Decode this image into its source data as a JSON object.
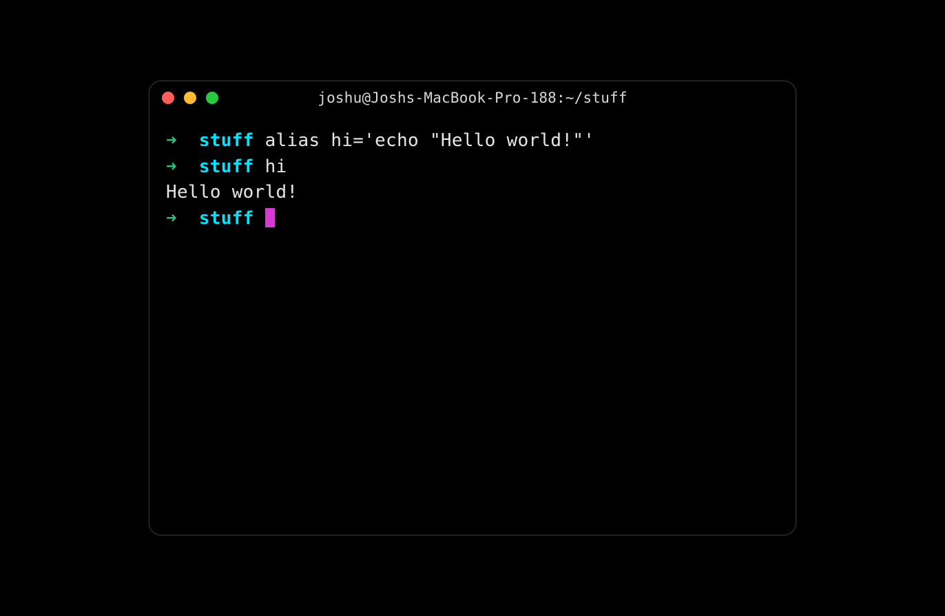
{
  "window": {
    "title": "joshu@Joshs-MacBook-Pro-188:~/stuff"
  },
  "colors": {
    "close": "#ff5f57",
    "minimize": "#febc2e",
    "maximize": "#28c840",
    "arrow": "#2ec27e",
    "dir": "#00e5ff",
    "cursor": "#d63bd1",
    "text": "#e6e6e6",
    "bg": "#000000"
  },
  "prompt": {
    "arrow": "➜",
    "dir": "stuff"
  },
  "lines": [
    {
      "type": "prompt",
      "command": "alias hi='echo \"Hello world!\"'"
    },
    {
      "type": "prompt",
      "command": "hi"
    },
    {
      "type": "output",
      "text": "Hello world!"
    },
    {
      "type": "prompt",
      "command": "",
      "cursor": true
    }
  ]
}
